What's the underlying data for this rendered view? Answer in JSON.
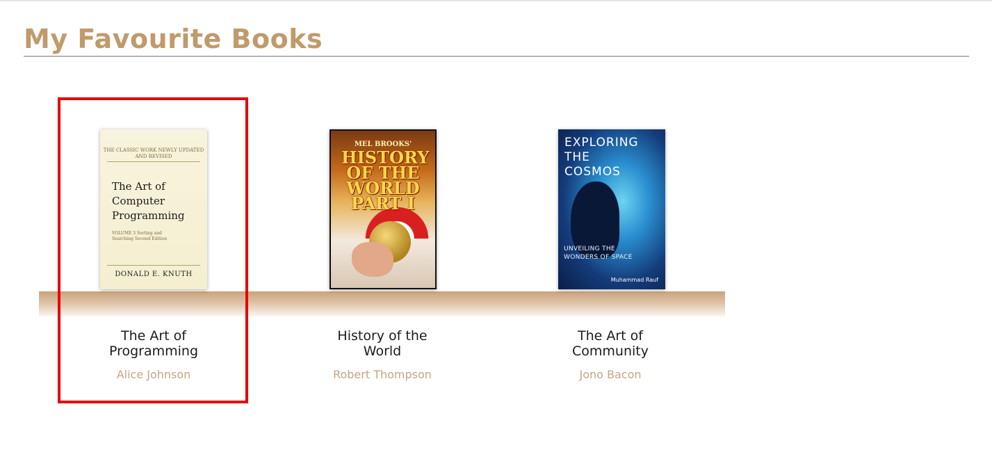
{
  "page": {
    "title": "My Favourite Books"
  },
  "books": [
    {
      "title": "The Art of Programming",
      "author": "Alice Johnson",
      "cover": {
        "top_text": "THE CLASSIC WORK NEWLY UPDATED AND REVISED",
        "title": "The Art of Computer Programming",
        "volume": "VOLUME 3 Sorting and Searching Second Edition",
        "author": "DONALD E. KNUTH"
      },
      "selected": true
    },
    {
      "title": "History of the World",
      "author": "Robert Thompson",
      "cover": {
        "brand": "MEL BROOKS'",
        "title": "HISTORY OF THE WORLD PART I"
      },
      "selected": false
    },
    {
      "title": "The Art of Community",
      "author": "Jono Bacon",
      "cover": {
        "title": "EXPLORING THE COSMOS",
        "subtitle": "UNVEILING THE WONDERS OF SPACE",
        "author": "Muhammad Rauf"
      },
      "selected": false
    }
  ],
  "colors": {
    "title": "#c19a6b",
    "author": "#c4a583",
    "highlight": "#e80000",
    "shelf": "#c9a27c"
  }
}
